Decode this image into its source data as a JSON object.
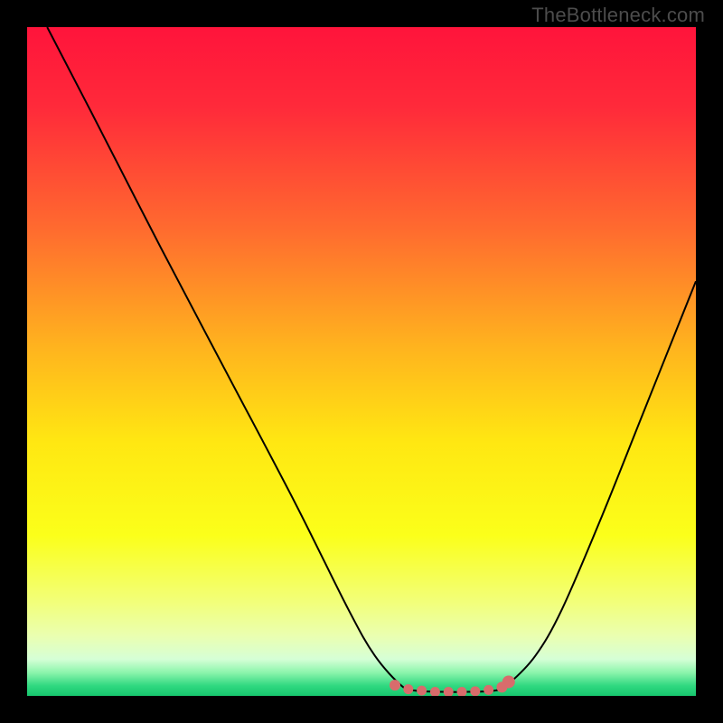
{
  "watermark": "TheBottleneck.com",
  "colors": {
    "frame": "#000000",
    "gradient_stops": [
      {
        "offset": 0.0,
        "color": "#ff143b"
      },
      {
        "offset": 0.12,
        "color": "#ff2a3a"
      },
      {
        "offset": 0.3,
        "color": "#ff6a2f"
      },
      {
        "offset": 0.48,
        "color": "#ffb41e"
      },
      {
        "offset": 0.62,
        "color": "#ffe712"
      },
      {
        "offset": 0.76,
        "color": "#fbff1a"
      },
      {
        "offset": 0.86,
        "color": "#f2ff7a"
      },
      {
        "offset": 0.91,
        "color": "#eaffb0"
      },
      {
        "offset": 0.945,
        "color": "#d6ffd6"
      },
      {
        "offset": 0.965,
        "color": "#8cf5ac"
      },
      {
        "offset": 0.985,
        "color": "#2fd880"
      },
      {
        "offset": 1.0,
        "color": "#17c76e"
      }
    ],
    "curve": "#000000",
    "marker_fill": "#d86c6c",
    "marker_stroke": "#c44f4f"
  },
  "chart_data": {
    "type": "line",
    "title": "",
    "xlabel": "",
    "ylabel": "",
    "xlim": [
      0,
      100
    ],
    "ylim": [
      0,
      100
    ],
    "series": [
      {
        "name": "bottleneck-curve",
        "x": [
          3,
          10,
          20,
          30,
          40,
          48,
          52,
          56,
          58,
          62,
          66,
          70,
          72,
          76,
          80,
          86,
          92,
          100
        ],
        "y": [
          100,
          86.5,
          67,
          48,
          29,
          13,
          6,
          1.5,
          0.8,
          0.6,
          0.6,
          0.8,
          1.8,
          6,
          13,
          27,
          42,
          62
        ]
      }
    ],
    "markers": {
      "name": "highlight-band",
      "x": [
        55,
        57,
        59,
        61,
        63,
        65,
        67,
        69,
        71,
        72
      ],
      "y": [
        1.6,
        1.0,
        0.8,
        0.6,
        0.6,
        0.6,
        0.7,
        0.9,
        1.3,
        2.1
      ],
      "r": [
        6,
        5.5,
        5.5,
        5.5,
        5.5,
        5.5,
        5.5,
        5.5,
        6,
        7
      ]
    }
  }
}
